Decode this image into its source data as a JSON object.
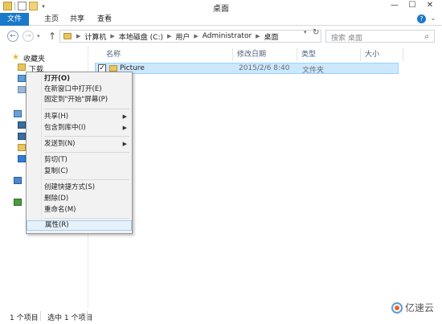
{
  "window": {
    "title": "桌面"
  },
  "ribbon": {
    "tabs": [
      "文件",
      "主页",
      "共享",
      "查看"
    ]
  },
  "address": {
    "crumbs": [
      "计算机",
      "本地磁盘 (C:)",
      "用户",
      "Administrator",
      "桌面"
    ],
    "search_placeholder": "搜索 桌面"
  },
  "sidebar": {
    "favorites_label": "收藏夹",
    "downloads_label": "下载"
  },
  "columns": {
    "name": "名称",
    "date": "修改日期",
    "type": "类型",
    "size": "大小"
  },
  "files": [
    {
      "name": "Picture",
      "date": "2015/2/6 8:40",
      "type": "文件夹",
      "checked": "✓"
    }
  ],
  "context_menu": {
    "items": [
      {
        "label": "打开(O)"
      },
      {
        "label": "在新窗口中打开(E)"
      },
      {
        "label": "固定到\"开始\"屏幕(P)"
      },
      {
        "label": "共享(H)",
        "submenu": "▶"
      },
      {
        "label": "包含到库中(I)",
        "submenu": "▶"
      },
      {
        "label": "发送到(N)",
        "submenu": "▶"
      },
      {
        "label": "剪切(T)"
      },
      {
        "label": "复制(C)"
      },
      {
        "label": "创建快捷方式(S)"
      },
      {
        "label": "删除(D)"
      },
      {
        "label": "重命名(M)"
      },
      {
        "label": "属性(R)"
      }
    ]
  },
  "status": {
    "count": "1 个项目",
    "selected": "选中 1 个项目"
  },
  "watermark": {
    "text": "亿速云"
  },
  "colors": {
    "accent": "#1979ca",
    "selection": "#cce8ff"
  }
}
